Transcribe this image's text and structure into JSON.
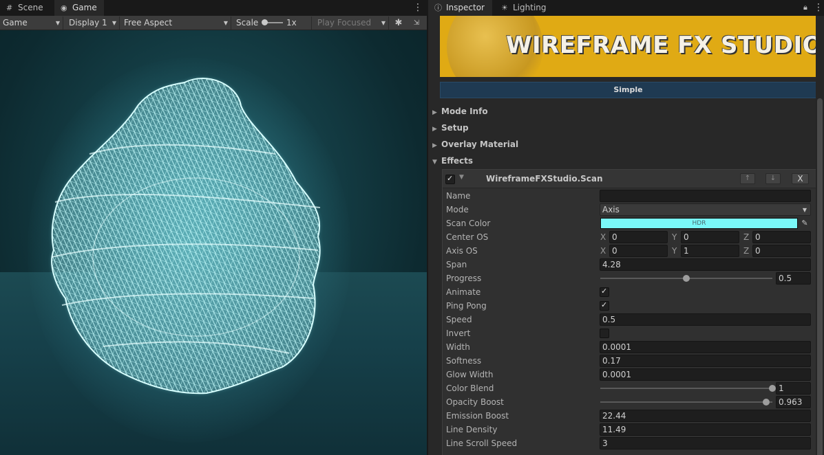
{
  "left_tabs": [
    {
      "label": "Scene",
      "icon": "grid-icon"
    },
    {
      "label": "Game",
      "icon": "gamepad-icon"
    }
  ],
  "toolbar": {
    "display_mode": "Game",
    "display": "Display 1",
    "aspect": "Free Aspect",
    "scale_label": "Scale",
    "scale_value": "1x",
    "play_mode": "Play Focused"
  },
  "right_tabs": [
    {
      "label": "Inspector",
      "icon": "info-icon"
    },
    {
      "label": "Lighting",
      "icon": "bulb-icon"
    }
  ],
  "banner": {
    "title": "WIREFRAME FX STUDIO"
  },
  "mode_button": "Simple",
  "sections": [
    "Mode Info",
    "Setup",
    "Overlay Material",
    "Effects"
  ],
  "effect": {
    "title": "WireframeFXStudio.Scan",
    "enabled": true,
    "close_label": "X",
    "up_label": "↑",
    "down_label": "↓"
  },
  "props": {
    "name": {
      "label": "Name",
      "value": ""
    },
    "mode": {
      "label": "Mode",
      "value": "Axis"
    },
    "scan_color": {
      "label": "Scan Color",
      "hdr": "HDR",
      "color": "#7af8f8"
    },
    "center_os": {
      "label": "Center OS",
      "x": "0",
      "y": "0",
      "z": "0"
    },
    "axis_os": {
      "label": "Axis OS",
      "x": "0",
      "y": "1",
      "z": "0"
    },
    "span": {
      "label": "Span",
      "value": "4.28"
    },
    "progress": {
      "label": "Progress",
      "value": "0.5",
      "fraction": 0.5
    },
    "animate": {
      "label": "Animate",
      "checked": true
    },
    "ping_pong": {
      "label": "Ping Pong",
      "checked": true
    },
    "speed": {
      "label": "Speed",
      "value": "0.5"
    },
    "invert": {
      "label": "Invert",
      "checked": false
    },
    "width": {
      "label": "Width",
      "value": "0.0001"
    },
    "softness": {
      "label": "Softness",
      "value": "0.17"
    },
    "glow_width": {
      "label": "Glow Width",
      "value": "0.0001"
    },
    "color_blend": {
      "label": "Color Blend",
      "value": "1",
      "fraction": 1.0
    },
    "opacity_boost": {
      "label": "Opacity Boost",
      "value": "0.963",
      "fraction": 0.963
    },
    "emission_boost": {
      "label": "Emission Boost",
      "value": "22.44"
    },
    "line_density": {
      "label": "Line Density",
      "value": "11.49"
    },
    "line_scroll_speed": {
      "label": "Line Scroll Speed",
      "value": "3"
    }
  },
  "axis_letters": {
    "x": "X",
    "y": "Y",
    "z": "Z"
  },
  "colors": {
    "accent_cyan": "#7af8f8",
    "banner_yellow": "#e0aa14",
    "mode_blue": "#1f3a52"
  }
}
